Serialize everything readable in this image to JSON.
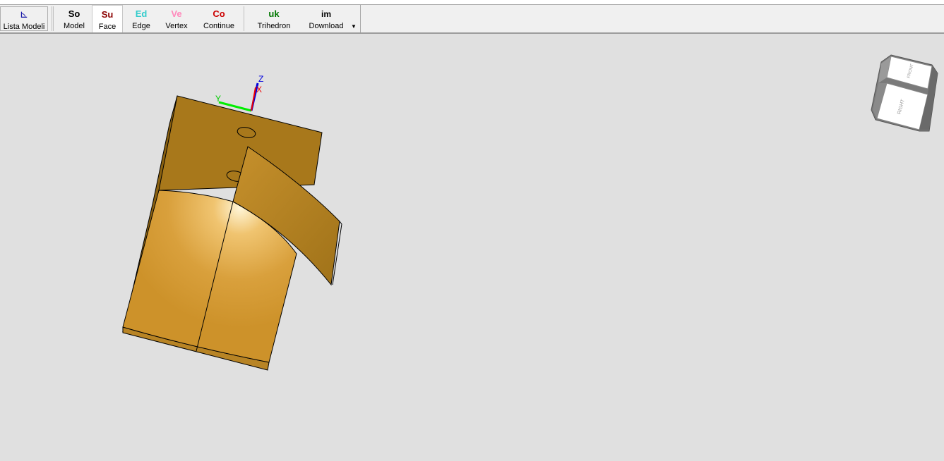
{
  "toolbar": {
    "buttons": [
      {
        "id": "lista",
        "icon": "⊾",
        "label": "Lista Modeli",
        "color": "#1a1aa8"
      },
      {
        "id": "model",
        "icon": "So",
        "label": "Model",
        "color": "#000000"
      },
      {
        "id": "face",
        "icon": "Su",
        "label": "Face",
        "color": "#8b0000",
        "active": true
      },
      {
        "id": "edge",
        "icon": "Ed",
        "label": "Edge",
        "color": "#33cccc"
      },
      {
        "id": "vertex",
        "icon": "Ve",
        "label": "Vertex",
        "color": "#ff88bb"
      },
      {
        "id": "continue",
        "icon": "Co",
        "label": "Continue",
        "color": "#cc0000"
      },
      {
        "id": "trihedron",
        "icon": "uk",
        "label": "Trihedron",
        "color": "#007700"
      },
      {
        "id": "download",
        "icon": "im",
        "label": "Download",
        "color": "#000000"
      }
    ]
  },
  "axes": {
    "x": "X",
    "y": "Y",
    "z": "Z"
  },
  "viewcube": {
    "top_face": "FRONT",
    "front_face": "RIGHT"
  },
  "colors": {
    "model_face": "#a8781b",
    "model_lit": "#d89a35",
    "background": "#e0e0e0"
  }
}
